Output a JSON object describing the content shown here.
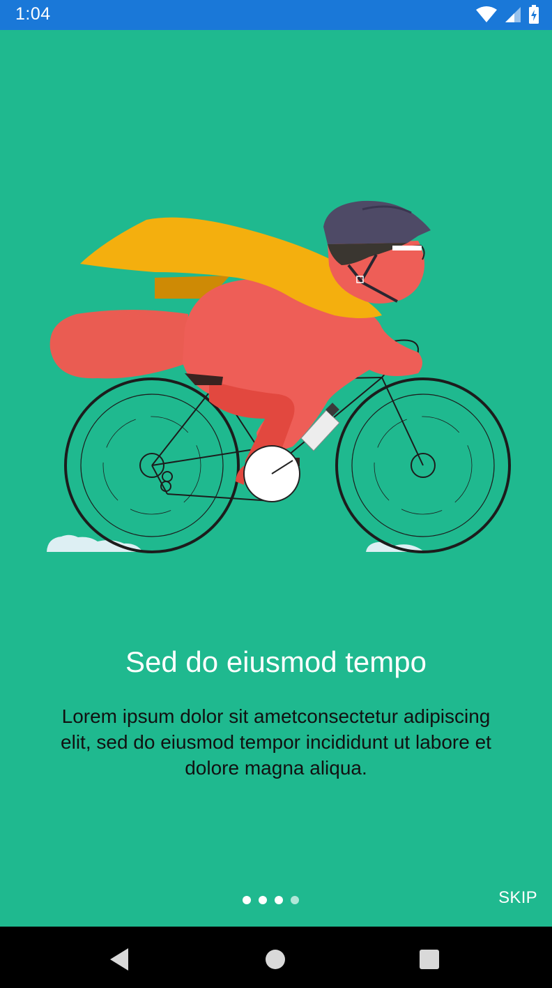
{
  "status_bar": {
    "time": "1:04",
    "icons": [
      "wifi-icon",
      "cell-signal-icon",
      "battery-icon"
    ],
    "color": "#1A78D8"
  },
  "onboarding": {
    "background_color": "#1FB98F",
    "title": "Sed do eiusmod tempo",
    "description": "Lorem ipsum dolor sit ametconsectetur adipiscing elit, sed do eiusmod tempor incididunt ut labore et dolore magna aliqua.",
    "page_indicator": {
      "total": 4,
      "current": 1
    },
    "skip_label": "SKIP"
  },
  "nav_bar": {
    "buttons": [
      "back-icon",
      "home-icon",
      "recents-icon"
    ]
  }
}
